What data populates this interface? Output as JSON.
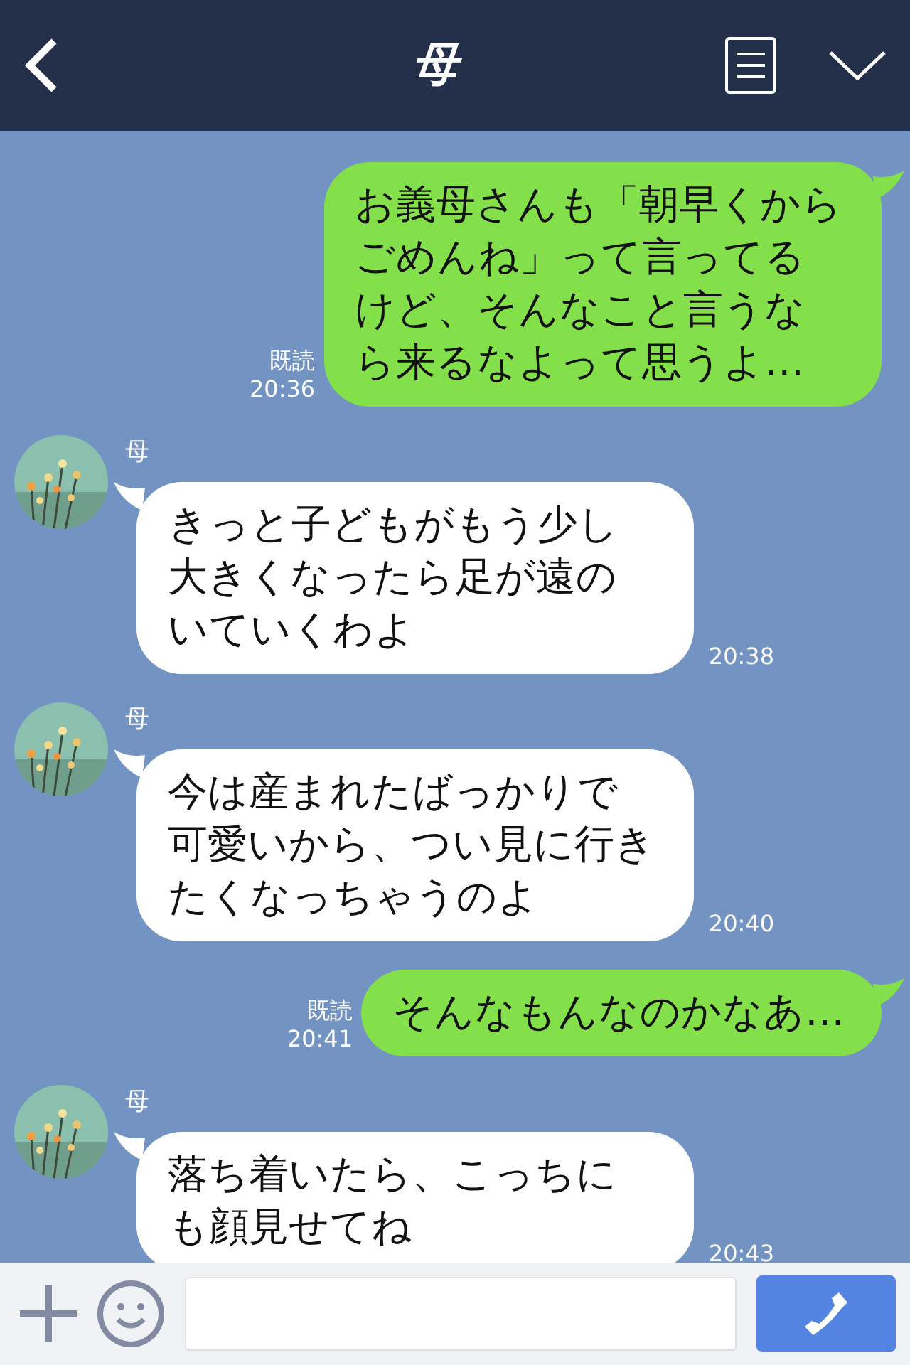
{
  "header": {
    "title": "母"
  },
  "messages": [
    {
      "kind": "sent",
      "text": "お義母さんも「朝早くからごめんね」って言ってるけど、そんなこと言うなら来るなよって思うよ…",
      "read": "既読",
      "time": "20:36"
    },
    {
      "kind": "received",
      "sender": "母",
      "text": "きっと子どもがもう少し大きくなったら足が遠のいていくわよ",
      "time": "20:38"
    },
    {
      "kind": "received",
      "sender": "母",
      "text": "今は産まれたばっかりで可愛いから、つい見に行きたくなっちゃうのよ",
      "time": "20:40"
    },
    {
      "kind": "sent",
      "text": "そんなもんなのかなあ…",
      "read": "既読",
      "time": "20:41"
    },
    {
      "kind": "received",
      "sender": "母",
      "text": "落ち着いたら、こっちにも顔見せてね",
      "time": "20:43"
    }
  ]
}
